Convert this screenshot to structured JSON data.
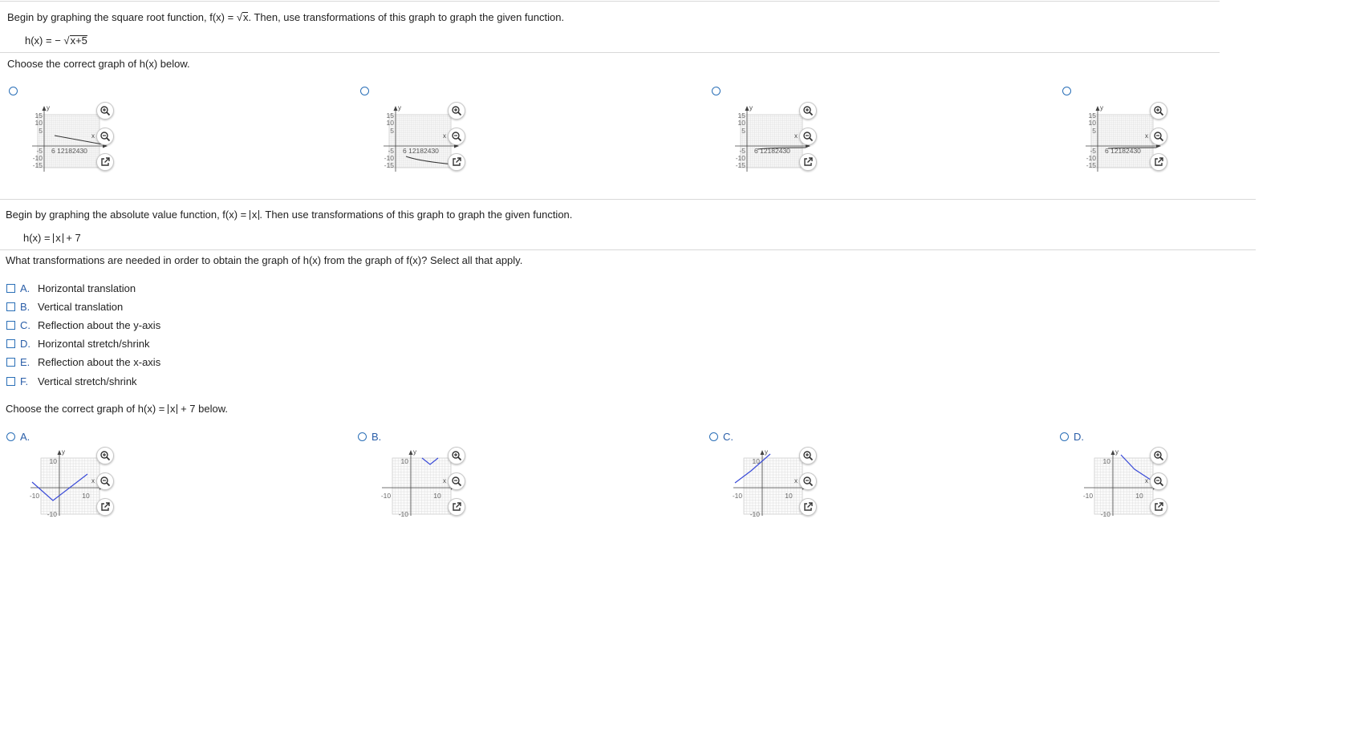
{
  "q1": {
    "prompt_pre": "Begin by graphing the square root function, f(x) = ",
    "prompt_rad": "x",
    "prompt_post": ". Then, use transformations of this graph to graph the given function.",
    "func_pre": "h(x) = − ",
    "func_rad": "x+5",
    "choose": "Choose the correct graph of h(x) below.",
    "options": [
      {
        "label": "",
        "y_ticks": [
          "15",
          "10",
          "5",
          "-5",
          "-10",
          "-15"
        ],
        "x_ticks": "6 12182430"
      },
      {
        "label": "",
        "y_ticks": [
          "15",
          "10",
          "5",
          "-5",
          "-10",
          "-15"
        ],
        "x_ticks": "6 12182430"
      },
      {
        "label": "",
        "y_ticks": [
          "15",
          "10",
          "5",
          "-5",
          "-10",
          "-15"
        ],
        "x_ticks": "6 12182430"
      },
      {
        "label": "",
        "y_ticks": [
          "15",
          "10",
          "5",
          "-5",
          "-10",
          "-15"
        ],
        "x_ticks": "6 12182430"
      }
    ]
  },
  "q2": {
    "prompt_pre": "Begin by graphing the absolute value function, f(x) = ",
    "prompt_abs": "x",
    "prompt_post": ". Then use transformations of  this graph to graph the given function.",
    "func_pre": "h(x) = ",
    "func_abs": "x",
    "func_post": " + 7",
    "question": "What transformations are needed in order to obtain the graph of h(x) from the graph of f(x)? Select all that apply.",
    "choices": [
      {
        "letter": "A.",
        "text": "Horizontal translation"
      },
      {
        "letter": "B.",
        "text": "Vertical translation"
      },
      {
        "letter": "C.",
        "text": "Reflection about the y-axis"
      },
      {
        "letter": "D.",
        "text": "Horizontal stretch/shrink"
      },
      {
        "letter": "E.",
        "text": "Reflection about the x-axis"
      },
      {
        "letter": "F.",
        "text": "Vertical stretch/shrink"
      }
    ],
    "choose_pre": "Choose the correct graph of h(x) = ",
    "choose_abs": "x",
    "choose_post": " + 7 below.",
    "options": [
      {
        "label": "A.",
        "tick_top": "10",
        "tick_bottom": "-10",
        "tick_left": "-10",
        "tick_right": "10"
      },
      {
        "label": "B.",
        "tick_top": "10",
        "tick_bottom": "-10",
        "tick_left": "-10",
        "tick_right": "10"
      },
      {
        "label": "C.",
        "tick_top": "10",
        "tick_bottom": "-10",
        "tick_left": "-10",
        "tick_right": "10"
      },
      {
        "label": "D.",
        "tick_top": "10",
        "tick_bottom": "-10",
        "tick_left": "-10",
        "tick_right": "10"
      }
    ]
  },
  "axis_labels": {
    "x": "x",
    "y": "y"
  },
  "icons": [
    "zoom-in-icon",
    "zoom-out-icon",
    "open-new-window-icon"
  ],
  "colors": {
    "radio": "#2a6fb7",
    "curve": "#3a4bd8",
    "grid": "#d9d9d9"
  }
}
